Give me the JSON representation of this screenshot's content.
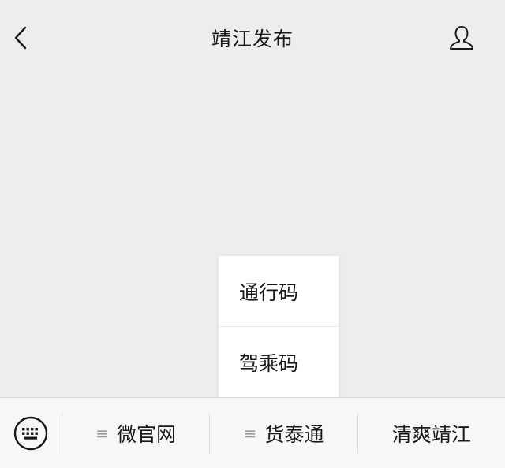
{
  "header": {
    "title": "靖江发布",
    "back_icon": "chevron-left-icon",
    "profile_icon": "user-icon"
  },
  "popup_menu": {
    "items": [
      {
        "label": "通行码"
      },
      {
        "label": "驾乘码"
      }
    ]
  },
  "bottom_menu": {
    "keyboard_icon": "keyboard-icon",
    "tabs": [
      {
        "label": "微官网",
        "has_submenu": true,
        "submenu_icon": "menu-lines-icon"
      },
      {
        "label": "货泰通",
        "has_submenu": true,
        "submenu_icon": "menu-lines-icon"
      },
      {
        "label": "清爽靖江",
        "has_submenu": false
      }
    ]
  },
  "colors": {
    "background": "#ededed",
    "bar_background": "#f7f7f7",
    "popup_background": "#ffffff",
    "text": "#181818",
    "muted_icon": "#9a9a9a"
  }
}
